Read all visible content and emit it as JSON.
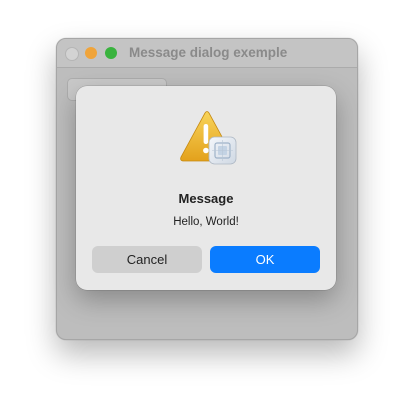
{
  "window": {
    "title": "Message dialog exemple",
    "traffic_lights": {
      "close": "#d3d3d3",
      "minimize": "#f0a43a",
      "zoom": "#39b33e"
    }
  },
  "dialog": {
    "icon": "warning-icon",
    "badge_icon": "app-icon",
    "title": "Message",
    "message": "Hello, World!",
    "cancel_label": "Cancel",
    "ok_label": "OK",
    "accent_color": "#0a7cff"
  }
}
